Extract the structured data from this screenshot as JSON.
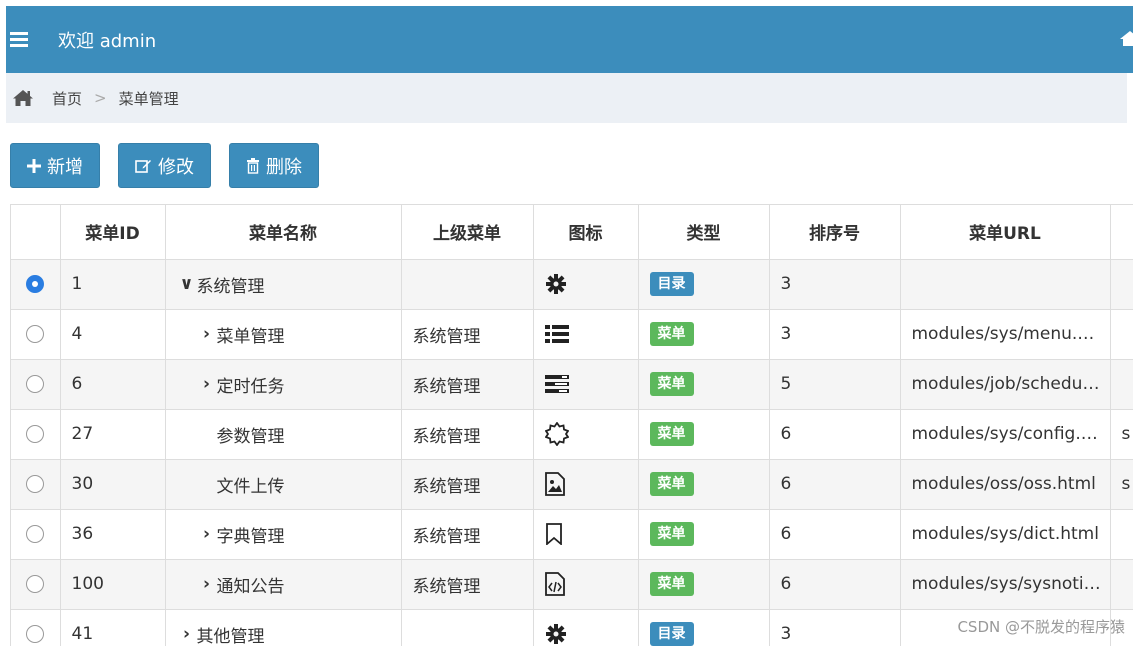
{
  "header": {
    "title": "欢迎 admin",
    "menu_icon": "hamburger-icon",
    "right_icon": "home-icon"
  },
  "breadcrumb": {
    "home_icon": "home-icon",
    "items": [
      "首页",
      "菜单管理"
    ],
    "separator": ">"
  },
  "toolbar": {
    "add_label": "新增",
    "edit_label": "修改",
    "delete_label": "删除",
    "add_icon": "plus-icon",
    "edit_icon": "edit-icon",
    "delete_icon": "trash-icon"
  },
  "table": {
    "headers": [
      "菜单ID",
      "菜单名称",
      "上级菜单",
      "图标",
      "类型",
      "排序号",
      "菜单URL"
    ],
    "rows": [
      {
        "selected": true,
        "id": "1",
        "name": "系统管理",
        "caret": "down",
        "parent": "",
        "icon": "gear-icon",
        "type": "目录",
        "order": "3",
        "url": "",
        "extra": ""
      },
      {
        "selected": false,
        "id": "4",
        "name": "菜单管理",
        "caret": "right",
        "parent": "系统管理",
        "icon": "list-icon",
        "type": "菜单",
        "order": "3",
        "url": "modules/sys/menu.…",
        "extra": ""
      },
      {
        "selected": false,
        "id": "6",
        "name": "定时任务",
        "caret": "right",
        "parent": "系统管理",
        "icon": "tasks-icon",
        "type": "菜单",
        "order": "5",
        "url": "modules/job/schedu…",
        "extra": ""
      },
      {
        "selected": false,
        "id": "27",
        "name": "参数管理",
        "caret": "none",
        "parent": "系统管理",
        "icon": "sun-icon",
        "type": "菜单",
        "order": "6",
        "url": "modules/sys/config.…",
        "extra": "s"
      },
      {
        "selected": false,
        "id": "30",
        "name": "文件上传",
        "caret": "none",
        "parent": "系统管理",
        "icon": "file-image-icon",
        "type": "菜单",
        "order": "6",
        "url": "modules/oss/oss.html",
        "extra": "s"
      },
      {
        "selected": false,
        "id": "36",
        "name": "字典管理",
        "caret": "right",
        "parent": "系统管理",
        "icon": "bookmark-icon",
        "type": "菜单",
        "order": "6",
        "url": "modules/sys/dict.html",
        "extra": ""
      },
      {
        "selected": false,
        "id": "100",
        "name": "通知公告",
        "caret": "right",
        "parent": "系统管理",
        "icon": "file-code-icon",
        "type": "菜单",
        "order": "6",
        "url": "modules/sys/sysnoti…",
        "extra": ""
      },
      {
        "selected": false,
        "id": "41",
        "name": "其他管理",
        "caret": "right",
        "parent": "",
        "icon": "gear-icon",
        "type": "目录",
        "order": "3",
        "url": "",
        "extra": ""
      }
    ]
  },
  "colors": {
    "primary": "#3c8dbc",
    "catalog_badge": "#3c8dbc",
    "menu_badge": "#5cb85c"
  },
  "watermark": "CSDN @不脱发的程序猿"
}
